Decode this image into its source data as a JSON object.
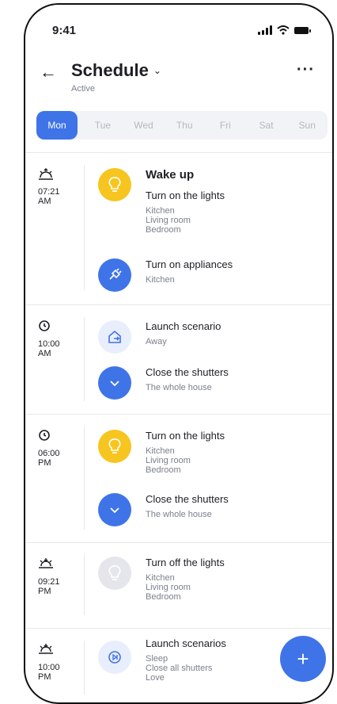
{
  "status": {
    "time": "9:41"
  },
  "header": {
    "title": "Schedule",
    "subtitle": "Active"
  },
  "days": [
    "Mon",
    "Tue",
    "Wed",
    "Thu",
    "Fri",
    "Sat",
    "Sun"
  ],
  "groups": [
    {
      "icon": "sunrise-icon",
      "time": [
        "07:21",
        "AM"
      ],
      "items": [
        {
          "title": "Wake up",
          "action": "Turn on the lights",
          "rooms": [
            "Kitchen",
            "Living room",
            "Bedroom"
          ],
          "icon": "bulb-icon",
          "color": "#F7C51F"
        },
        {
          "action": "Turn on appliances",
          "rooms": [
            "Kitchen"
          ],
          "icon": "plug-icon",
          "color": "#3F74E8"
        }
      ]
    },
    {
      "icon": "clock-icon",
      "time": [
        "10:00",
        "AM"
      ],
      "items": [
        {
          "action": "Launch scenario",
          "rooms": [
            "Away"
          ],
          "icon": "leave-home-icon",
          "color": "#E9EEFC"
        },
        {
          "action": "Close the shutters",
          "rooms": [
            "The whole house"
          ],
          "icon": "chevron-down-icon",
          "color": "#3F74E8"
        }
      ]
    },
    {
      "icon": "clock-icon",
      "time": [
        "06:00",
        "PM"
      ],
      "items": [
        {
          "action": "Turn on the lights",
          "rooms": [
            "Kitchen",
            "Living room",
            "Bedroom"
          ],
          "icon": "bulb-icon",
          "color": "#F7C51F"
        },
        {
          "action": "Close the shutters",
          "rooms": [
            "The whole house"
          ],
          "icon": "chevron-down-icon",
          "color": "#3F74E8"
        }
      ]
    },
    {
      "icon": "sunset-icon",
      "time": [
        "09:21",
        "PM"
      ],
      "items": [
        {
          "action": "Turn off the lights",
          "rooms": [
            "Kitchen",
            "Living room",
            "Bedroom"
          ],
          "icon": "bulb-off-icon",
          "color": "#E4E6EB"
        }
      ]
    },
    {
      "icon": "sunset-icon",
      "time": [
        "10:00",
        "PM"
      ],
      "items": [
        {
          "action": "Launch scenarios",
          "rooms": [
            "Sleep",
            "Close all shutters",
            "Love"
          ],
          "icon": "play-scenario-icon",
          "color": "#E9EEFC"
        }
      ]
    }
  ],
  "fab": {
    "label": "+"
  }
}
